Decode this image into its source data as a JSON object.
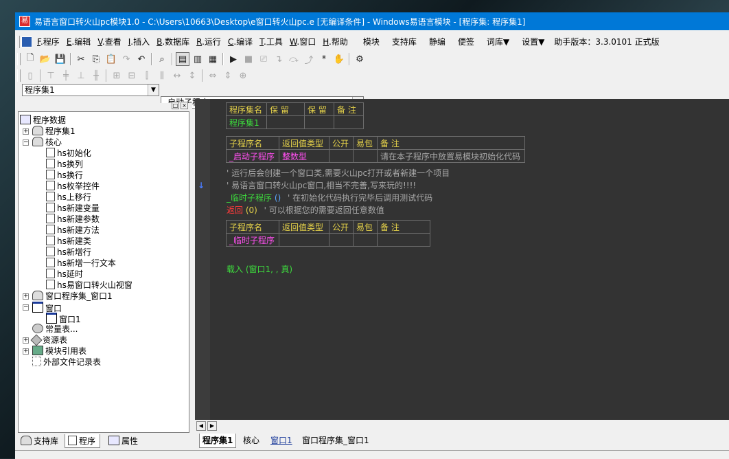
{
  "window": {
    "title": "易语言窗口转火山pc模块1.0 - C:\\Users\\10663\\Desktop\\e窗口转火山pc.e [无编译条件] - Windows易语言模块 - [程序集: 程序集1]"
  },
  "menu": {
    "items": [
      {
        "key": "F",
        "label": ".程序"
      },
      {
        "key": "E",
        "label": ".编辑"
      },
      {
        "key": "V",
        "label": ".查看"
      },
      {
        "key": "I",
        "label": ".插入"
      },
      {
        "key": "B",
        "label": ".数据库"
      },
      {
        "key": "R",
        "label": ".运行"
      },
      {
        "key": "C",
        "label": ".编译"
      },
      {
        "key": "T",
        "label": ".工具"
      },
      {
        "key": "W",
        "label": ".窗口"
      },
      {
        "key": "H",
        "label": ".帮助"
      }
    ],
    "extra": [
      "模块",
      "支持库",
      "静编",
      "便签",
      "词库▼",
      "设置▼"
    ],
    "version": "助手版本：3.3.0101 正式版"
  },
  "combos": {
    "left": "程序集1",
    "right": "_启动子程序"
  },
  "tree": {
    "root": "程序数据",
    "nodes": [
      {
        "label": "程序集1"
      },
      {
        "label": "核心"
      },
      {
        "label": "hs初始化"
      },
      {
        "label": "hs换列"
      },
      {
        "label": "hs换行"
      },
      {
        "label": "hs枚举控件"
      },
      {
        "label": "hs上移行"
      },
      {
        "label": "hs新建变量"
      },
      {
        "label": "hs新建参数"
      },
      {
        "label": "hs新建方法"
      },
      {
        "label": "hs新建类"
      },
      {
        "label": "hs新增行"
      },
      {
        "label": "hs新增一行文本"
      },
      {
        "label": "hs延时"
      },
      {
        "label": "hs易窗口转火山视窗"
      },
      {
        "label": "窗口程序集_窗口1"
      },
      {
        "label": "窗口"
      },
      {
        "label": "窗口1"
      },
      {
        "label": "常量表..."
      },
      {
        "label": "资源表"
      },
      {
        "label": "模块引用表"
      },
      {
        "label": "外部文件记录表"
      }
    ]
  },
  "left_tabs": [
    "支持库",
    "程序",
    "属性"
  ],
  "code": {
    "set_table": {
      "headers": [
        "程序集名",
        "保 留",
        "保 留",
        "备 注"
      ],
      "row": [
        "程序集1",
        "",
        "",
        ""
      ]
    },
    "sub_table1": {
      "headers": [
        "子程序名",
        "返回值类型",
        "公开",
        "易包",
        "备 注"
      ],
      "row": [
        "_启动子程序",
        "整数型",
        "",
        "",
        "请在本子程序中放置易模块初始化代码"
      ]
    },
    "comment1": "' 运行后会创建一个窗口类,需要火山pc打开或者新建一个项目",
    "comment2": "' 易语言窗口转火山pc窗口,相当不完善,写来玩的!!!!",
    "call_name": "_临时子程序",
    "call_parens": "()",
    "call_comment": "' 在初始化代码执行完毕后调用测试代码",
    "return_kw": "返回",
    "return_arg": "(0)",
    "return_comment": "' 可以根据您的需要返回任意数值",
    "sub_table2": {
      "headers": [
        "子程序名",
        "返回值类型",
        "公开",
        "易包",
        "备 注"
      ],
      "row": [
        "_临时子程序",
        "",
        "",
        "",
        ""
      ]
    },
    "load_line": "载入 (窗口1, , 真)",
    "arrow": "↓"
  },
  "code_tabs": [
    "程序集1",
    "核心",
    "窗口1",
    "窗口程序集_窗口1"
  ],
  "colors": {
    "title_bg": "#0078d7",
    "code_bg": "#333333",
    "header_yellow": "#e6d24a",
    "green": "#3ddc3d",
    "magenta": "#ff4ff0",
    "gray_comment": "#a8a8a8",
    "red": "#ff3b3b"
  }
}
